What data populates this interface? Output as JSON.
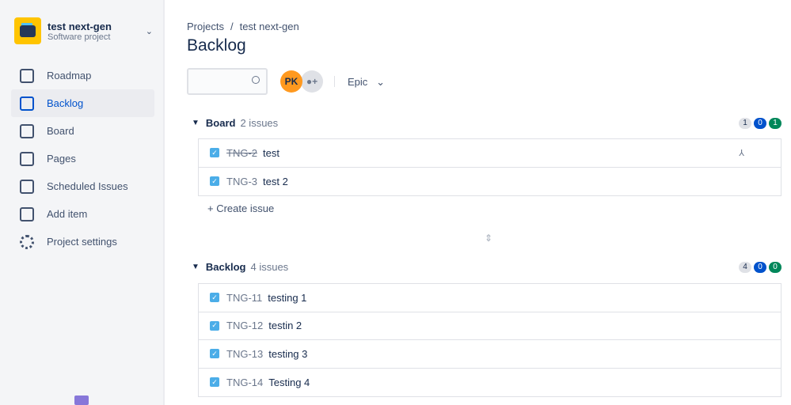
{
  "project": {
    "name": "test next-gen",
    "type": "Software project"
  },
  "nav": [
    {
      "label": "Roadmap"
    },
    {
      "label": "Backlog"
    },
    {
      "label": "Board"
    },
    {
      "label": "Pages"
    },
    {
      "label": "Scheduled Issues"
    },
    {
      "label": "Add item"
    },
    {
      "label": "Project settings"
    }
  ],
  "breadcrumb": [
    "Projects",
    "/",
    "test next-gen"
  ],
  "title": "Backlog",
  "search": {
    "placeholder": ""
  },
  "avatar": "PK",
  "epic_label": "Epic",
  "create_issue": "+ Create issue",
  "sections": [
    {
      "name": "Board",
      "count": "2 issues",
      "badges": [
        "1",
        "0",
        "1"
      ],
      "issues": [
        {
          "key": "TNG-2",
          "summary": "test",
          "done": true
        },
        {
          "key": "TNG-3",
          "summary": "test 2"
        }
      ]
    },
    {
      "name": "Backlog",
      "count": "4 issues",
      "badges": [
        "4",
        "0",
        "0"
      ],
      "issues": [
        {
          "key": "TNG-11",
          "summary": "testing 1"
        },
        {
          "key": "TNG-12",
          "summary": "testin 2"
        },
        {
          "key": "TNG-13",
          "summary": "testing 3"
        },
        {
          "key": "TNG-14",
          "summary": "Testing 4"
        }
      ]
    }
  ]
}
